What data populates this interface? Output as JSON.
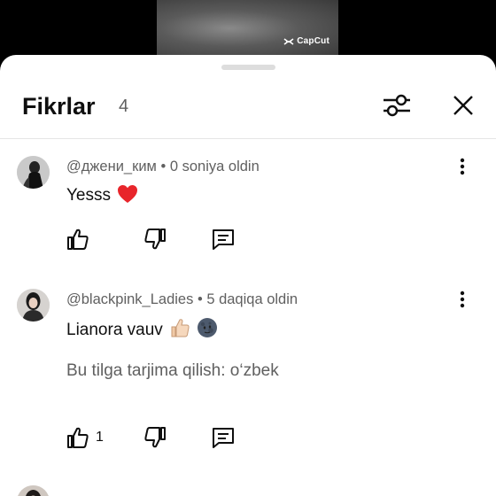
{
  "video": {
    "watermark_text": "CapCut"
  },
  "comments_panel": {
    "title": "Fikrlar",
    "count": "4"
  },
  "comments": [
    {
      "author": "@джени_ким",
      "separator": "•",
      "time": "0 soniya oldin",
      "text": "Yesss",
      "emoji": "red-heart",
      "like_count": ""
    },
    {
      "author": "@blackpink_Ladies",
      "separator": "•",
      "time": "5 daqiqa oldin",
      "text": "Lianora vauv",
      "emoji": "thumbs-up-light-skin, new-moon-face",
      "translate_label": "Bu tilga tarjima qilish: o‘zbek",
      "like_count": "1"
    }
  ],
  "colors": {
    "text_primary": "#0f0f0f",
    "text_secondary": "#606060",
    "divider": "#e5e5e5",
    "heart": "#e8252b"
  }
}
